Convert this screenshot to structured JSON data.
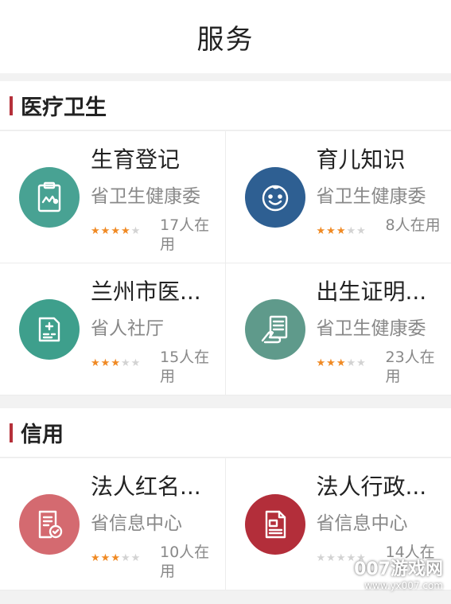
{
  "header": {
    "title": "服务"
  },
  "colors": {
    "accent_bar": "#b5303a",
    "star_on": "#f08a24",
    "star_off": "#d3d3d3"
  },
  "sections": [
    {
      "title": "医疗卫生",
      "items": [
        {
          "name": "生育登记",
          "org": "省卫生健康委",
          "stars": 4,
          "users": "17人在用",
          "icon": "clipboard-icon",
          "color": "#48a293"
        },
        {
          "name": "育儿知识",
          "org": "省卫生健康委",
          "stars": 3,
          "users": "8人在用",
          "icon": "baby-face-icon",
          "color": "#2e5f92"
        },
        {
          "name": "兰州市医...",
          "org": "省人社厅",
          "stars": 3,
          "users": "15人在用",
          "icon": "medical-document-icon",
          "color": "#3e9f8c"
        },
        {
          "name": "出生证明...",
          "org": "省卫生健康委",
          "stars": 3,
          "users": "23人在用",
          "icon": "hand-document-icon",
          "color": "#5f9a8b"
        }
      ]
    },
    {
      "title": "信用",
      "items": [
        {
          "name": "法人红名...",
          "org": "省信息中心",
          "stars": 3,
          "users": "10人在用",
          "icon": "document-check-icon",
          "color": "#d46a70"
        },
        {
          "name": "法人行政...",
          "org": "省信息中心",
          "stars": 0,
          "users": "14人在",
          "icon": "document-list-icon",
          "color": "#b32e3a"
        }
      ]
    }
  ],
  "watermark": {
    "main": "007游戏网",
    "sub": "www.yx007.com"
  }
}
